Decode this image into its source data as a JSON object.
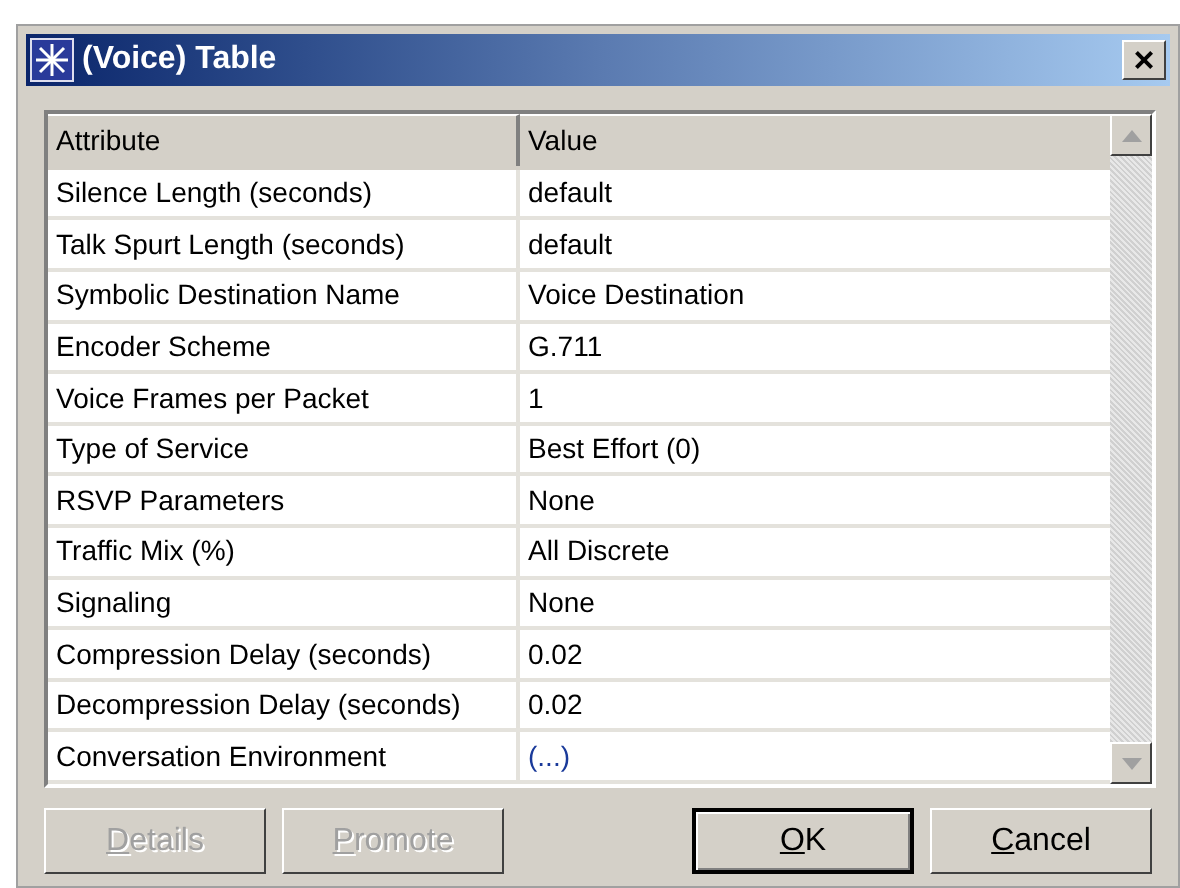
{
  "window": {
    "title": "(Voice) Table",
    "close": "×"
  },
  "table": {
    "columns": [
      "Attribute",
      "Value"
    ],
    "rows": [
      {
        "attribute": "Silence Length (seconds)",
        "value": "default",
        "kind": "text"
      },
      {
        "attribute": "Talk Spurt Length (seconds)",
        "value": "default",
        "kind": "text"
      },
      {
        "attribute": "Symbolic Destination Name",
        "value": "Voice Destination",
        "kind": "text"
      },
      {
        "attribute": "Encoder Scheme",
        "value": "G.711",
        "kind": "text"
      },
      {
        "attribute": "Voice Frames per Packet",
        "value": "1",
        "kind": "text"
      },
      {
        "attribute": "Type of Service",
        "value": "Best Effort (0)",
        "kind": "text"
      },
      {
        "attribute": "RSVP Parameters",
        "value": "None",
        "kind": "text"
      },
      {
        "attribute": "Traffic Mix (%)",
        "value": "All Discrete",
        "kind": "text"
      },
      {
        "attribute": "Signaling",
        "value": "None",
        "kind": "text"
      },
      {
        "attribute": "Compression Delay (seconds)",
        "value": "0.02",
        "kind": "text"
      },
      {
        "attribute": "Decompression Delay (seconds)",
        "value": "0.02",
        "kind": "text"
      },
      {
        "attribute": "Conversation Environment",
        "value": "(...)",
        "kind": "compound"
      }
    ]
  },
  "buttons": [
    {
      "label": "Details",
      "disabled": true,
      "default": false
    },
    {
      "label": "Promote",
      "disabled": true,
      "default": false
    },
    {
      "label": "OK",
      "disabled": false,
      "default": true
    },
    {
      "label": "Cancel",
      "disabled": false,
      "default": false
    }
  ]
}
